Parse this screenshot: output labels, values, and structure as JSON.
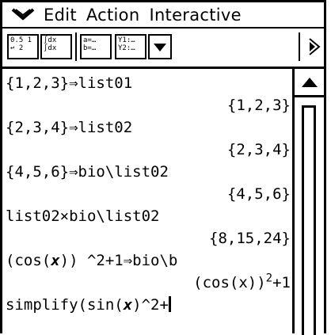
{
  "menu": {
    "arrow_icon": "menu-down-arrow-icon",
    "items": [
      "Edit",
      "Action",
      "Interactive"
    ]
  },
  "toolbar": {
    "buttons": [
      {
        "name": "fraction-decimal-toggle",
        "text": "0.5 1\n↩ 2"
      },
      {
        "name": "integral-mode-toggle",
        "text": "∫dx\n∫dx"
      },
      {
        "name": "assignment-tool",
        "text": "a=…\nb=…"
      },
      {
        "name": "graph-tool",
        "text": "Y1:…\nY2:…"
      }
    ],
    "dropdown_icon": "dropdown-arrow-icon",
    "more_icon": "toolbar-scroll-right-icon"
  },
  "work_area": {
    "lines": [
      {
        "kind": "in",
        "text": "{1,2,3}⇒list01"
      },
      {
        "kind": "out",
        "text": "{1,2,3}"
      },
      {
        "kind": "in",
        "text": "{2,3,4}⇒list02"
      },
      {
        "kind": "out",
        "text": "{2,3,4}"
      },
      {
        "kind": "in",
        "text": "{4,5,6}⇒bio\\list02"
      },
      {
        "kind": "out",
        "text": "{4,5,6}"
      },
      {
        "kind": "in",
        "text": "list02×bio\\list02"
      },
      {
        "kind": "out",
        "text": "{8,15,24}"
      }
    ],
    "expr_line": {
      "pre": "(cos(",
      "var": "x",
      "post": ")) ^2+1⇒bio\\b"
    },
    "expr_result": {
      "base": "(cos(x))",
      "exp": "2",
      "tail": "+1"
    },
    "current_input": {
      "pre": "simplify(sin(",
      "var": "x",
      "post": ")^2+"
    }
  },
  "scrollbar": {
    "up_icon": "scroll-up-arrow-icon"
  }
}
